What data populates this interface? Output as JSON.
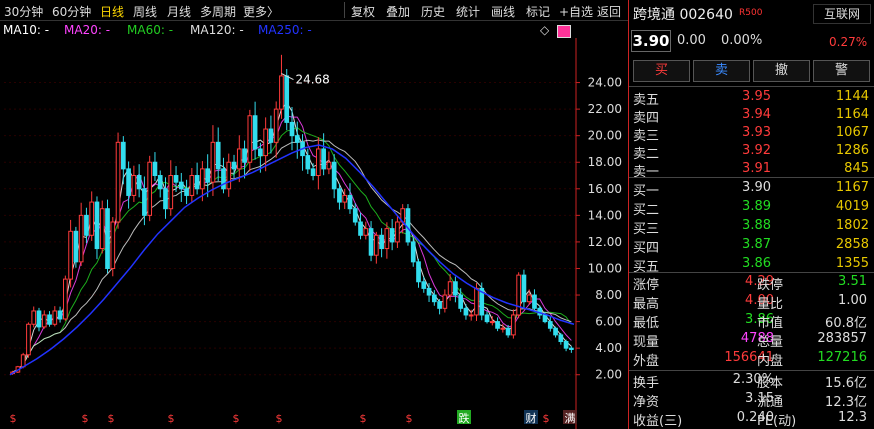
{
  "toolbar": {
    "periods": [
      "30分钟",
      "60分钟",
      "日线",
      "周线",
      "月线",
      "多周期",
      "更多〉"
    ],
    "active_period": "日线",
    "tools": [
      "复权",
      "叠加",
      "历史",
      "统计",
      "画线",
      "标记",
      "+自选",
      "返回"
    ]
  },
  "ma_legend": [
    {
      "label": "MA10: -",
      "color": "#ffffff"
    },
    {
      "label": "MA20: -",
      "color": "#ff44ff"
    },
    {
      "label": "MA60: -",
      "color": "#22cc22"
    },
    {
      "label": "MA120: -",
      "color": "#dddddd"
    },
    {
      "label": "MA250: -",
      "color": "#2233ff"
    }
  ],
  "chart_data": {
    "type": "candlestick",
    "yticks": [
      "24.00",
      "22.00",
      "20.00",
      "18.00",
      "16.00",
      "14.00",
      "12.00",
      "10.00",
      "8.00",
      "6.00",
      "4.00",
      "2.00"
    ],
    "ylim": [
      1.0,
      26.0
    ],
    "max_label": "24.68",
    "closes": [
      2.2,
      2.6,
      3.5,
      5.8,
      6.8,
      5.6,
      6.5,
      5.8,
      6.8,
      6.2,
      9.2,
      12.8,
      10.5,
      14.0,
      12.5,
      15.0,
      11.5,
      14.5,
      10.0,
      13.5,
      19.5,
      17.5,
      15.5,
      17.0,
      16.0,
      14.0,
      18.0,
      17.0,
      16.0,
      14.5,
      17.0,
      16.5,
      16.0,
      15.5,
      17.0,
      16.0,
      17.5,
      16.5,
      19.5,
      17.5,
      16.0,
      18.0,
      17.5,
      19.0,
      18.0,
      21.5,
      19.0,
      18.5,
      20.5,
      19.5,
      22.0,
      24.5,
      21.0,
      20.0,
      19.5,
      18.5,
      17.5,
      17.0,
      19.0,
      17.5,
      18.0,
      16.0,
      15.0,
      15.5,
      14.5,
      13.5,
      12.5,
      13.0,
      11.0,
      12.5,
      11.5,
      13.0,
      12.0,
      13.5,
      14.5,
      12.0,
      10.5,
      9.0,
      8.5,
      8.0,
      7.5,
      7.0,
      8.0,
      9.0,
      8.0,
      7.0,
      6.5,
      6.5,
      8.5,
      6.5,
      6.0,
      6.0,
      5.5,
      5.5,
      5.0,
      6.5,
      9.5,
      7.5,
      8.0,
      7.0,
      6.5,
      6.0,
      5.5,
      5.0,
      4.5,
      4.0,
      3.9
    ],
    "ma250": [
      2.0,
      2.6,
      3.2,
      3.9,
      4.7,
      5.6,
      6.6,
      7.7,
      8.9,
      10.1,
      11.4,
      12.6,
      13.6,
      14.6,
      15.3,
      15.9,
      16.4,
      16.8,
      17.2,
      17.7,
      18.2,
      18.7,
      19.1,
      19.3,
      19.0,
      18.3,
      17.3,
      16.2,
      15.0,
      13.8,
      12.6,
      11.5,
      10.5,
      9.6,
      8.9,
      8.3,
      7.8,
      7.4,
      7.1,
      6.8,
      6.5,
      6.1,
      5.8
    ],
    "events": [
      "$",
      "$",
      "$",
      "$",
      "$",
      "$",
      "$",
      "$",
      "跌",
      "财",
      "$",
      "满"
    ]
  },
  "stock": {
    "name": "跨境通",
    "code": "002640",
    "rzrq": "R",
    "rzrq_sub": "500",
    "industry": "互联网",
    "industry_pct": "0.27%",
    "price": "3.90",
    "change": "0.00",
    "change_pct": "0.00%"
  },
  "buttons": {
    "buy": "买",
    "sell": "卖",
    "cancel": "撤",
    "alert": "警"
  },
  "asks": [
    {
      "label": "卖五",
      "price": "3.95",
      "vol": "1144"
    },
    {
      "label": "卖四",
      "price": "3.94",
      "vol": "1164"
    },
    {
      "label": "卖三",
      "price": "3.93",
      "vol": "1067"
    },
    {
      "label": "卖二",
      "price": "3.92",
      "vol": "1286"
    },
    {
      "label": "卖一",
      "price": "3.91",
      "vol": "845"
    }
  ],
  "bids": [
    {
      "label": "买一",
      "price": "3.90",
      "vol": "1167"
    },
    {
      "label": "买二",
      "price": "3.89",
      "vol": "4019"
    },
    {
      "label": "买三",
      "price": "3.88",
      "vol": "1802"
    },
    {
      "label": "买四",
      "price": "3.87",
      "vol": "2858"
    },
    {
      "label": "买五",
      "price": "3.86",
      "vol": "1355"
    }
  ],
  "stats1": [
    {
      "l1": "涨停",
      "v1": "4.29",
      "c1": "red",
      "l2": "跌停",
      "v2": "3.51",
      "c2": "green"
    },
    {
      "l1": "最高",
      "v1": "4.00",
      "c1": "red",
      "l2": "量比",
      "v2": "1.00",
      "c2": "white"
    },
    {
      "l1": "最低",
      "v1": "3.86",
      "c1": "green",
      "l2": "市值",
      "v2": "60.8亿",
      "c2": "white"
    },
    {
      "l1": "现量",
      "v1": "4788",
      "c1": "mag",
      "l2": "总量",
      "v2": "283857",
      "c2": "white"
    },
    {
      "l1": "外盘",
      "v1": "156641",
      "c1": "red",
      "l2": "内盘",
      "v2": "127216",
      "c2": "green"
    }
  ],
  "stats2": [
    {
      "l1": "换手",
      "v1": "2.30%",
      "l2": "股本",
      "v2": "15.6亿"
    },
    {
      "l1": "净资",
      "v1": "3.15",
      "l2": "流通",
      "v2": "12.3亿"
    },
    {
      "l1": "收益(三)",
      "v1": "0.240",
      "l2": "PE(动)",
      "v2": "12.3"
    }
  ]
}
